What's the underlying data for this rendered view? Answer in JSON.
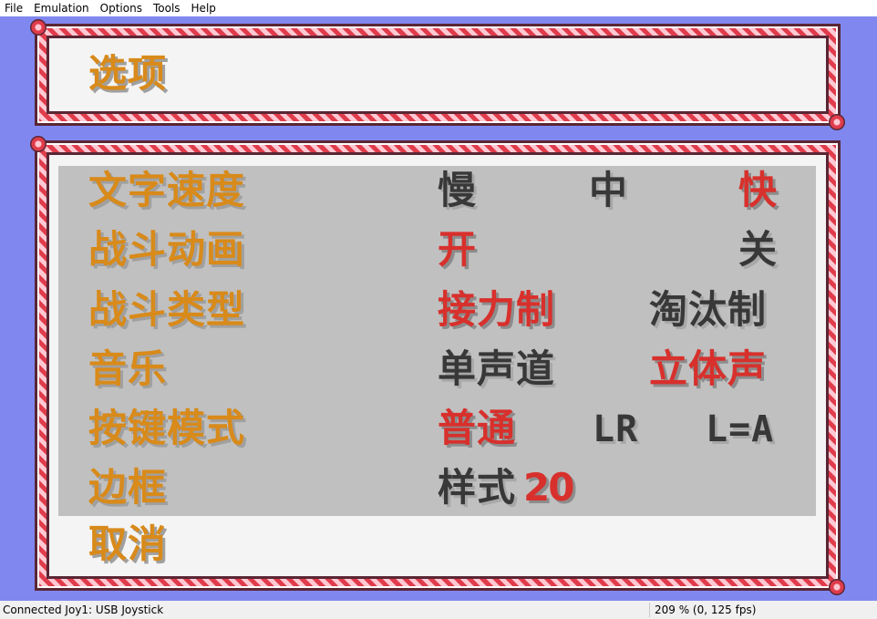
{
  "menu": {
    "items": [
      "File",
      "Emulation",
      "Options",
      "Tools",
      "Help"
    ]
  },
  "game": {
    "title": "选项",
    "rows": [
      {
        "label": "文字速度",
        "options": [
          "慢",
          "中",
          "快"
        ],
        "selected": [
          2
        ]
      },
      {
        "label": "战斗动画",
        "options": [
          "开",
          "关"
        ],
        "selected": [
          0
        ]
      },
      {
        "label": "战斗类型",
        "options": [
          "接力制",
          "淘汰制"
        ],
        "selected": [
          0
        ]
      },
      {
        "label": "音乐",
        "options": [
          "单声道",
          "立体声"
        ],
        "selected": [
          1
        ]
      },
      {
        "label": "按键模式",
        "options": [
          "普通",
          "LR",
          "L=A"
        ],
        "selected": [
          0
        ]
      },
      {
        "label": "边框",
        "options": [
          "样式",
          "20"
        ],
        "selected": [
          1
        ]
      }
    ],
    "cancel_label": "取消",
    "colors": {
      "background": "#8088f0",
      "frame_stripe": "#e03c4c",
      "label_gold": "#d88a1a",
      "selected_red": "#d8302c",
      "unselected_dark": "#383838",
      "panel_gray": "#c0c0c0"
    }
  },
  "status": {
    "left": "Connected Joy1: USB Joystick",
    "right": "209 % (0, 125 fps)"
  }
}
